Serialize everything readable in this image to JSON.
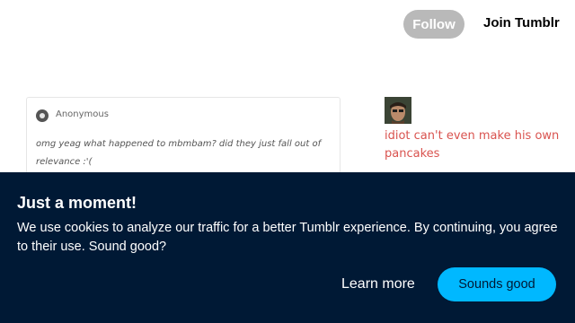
{
  "header": {
    "follow_label": "Follow",
    "join_label": "Join Tumblr"
  },
  "ask": {
    "asker_name": "Anonymous",
    "asker_icon": "anonymous-icon",
    "question": "omg yeag what happened to mbmbam? did they just fall out of relevance :'("
  },
  "sidebar": {
    "description": "idiot can't even make his own pancakes"
  },
  "cookie_banner": {
    "title": "Just a moment!",
    "body": "We use cookies to analyze our traffic for a better Tumblr experience. By continuing, you agree to their use. Sound good?",
    "learn_more_label": "Learn more",
    "accept_label": "Sounds good",
    "background_color": "#001935",
    "accent_color": "#00b8ff"
  },
  "colors": {
    "link_red": "#d9534f",
    "follow_gray": "#b9b9b9"
  }
}
